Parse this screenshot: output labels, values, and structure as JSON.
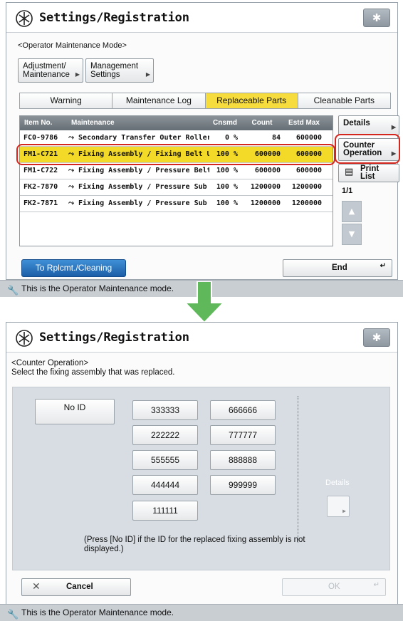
{
  "top": {
    "title": "Settings/Registration",
    "mode_label": "<Operator Maintenance Mode>",
    "nav": {
      "adjustment_line1": "Adjustment/",
      "adjustment_line2": "Maintenance",
      "management_line1": "Management",
      "management_line2": "Settings"
    },
    "tabs": [
      "Warning",
      "Maintenance Log",
      "Replaceable Parts",
      "Cleanable Parts"
    ],
    "active_tab": "Replaceable Parts",
    "table": {
      "headers": [
        "Item No.",
        "Maintenance",
        "Cnsmd",
        "Count",
        "Estd Max"
      ],
      "rows": [
        {
          "item": "FC0-9786",
          "name": "Secondary Transfer Outer Roller",
          "cnsmd": "0 %",
          "count": "84",
          "max": "600000"
        },
        {
          "item": "FM1-C721",
          "name": "Fixing Assembly / Fixing Belt Uni",
          "cnsmd": "100 %",
          "count": "600000",
          "max": "600000"
        },
        {
          "item": "FM1-C722",
          "name": "Fixing Assembly / Pressure Belt U",
          "cnsmd": "100 %",
          "count": "600000",
          "max": "600000"
        },
        {
          "item": "FK2-7870",
          "name": "Fixing Assembly / Pressure Sub Th",
          "cnsmd": "100 %",
          "count": "1200000",
          "max": "1200000"
        },
        {
          "item": "FK2-7871",
          "name": "Fixing Assembly / Pressure Sub Th",
          "cnsmd": "100 %",
          "count": "1200000",
          "max": "1200000"
        }
      ]
    },
    "side": {
      "details": "Details",
      "counter_line1": "Counter",
      "counter_line2": "Operation",
      "print_line1": "Print",
      "print_line2": "List",
      "page": "1/1"
    },
    "to_replacement": "To Rplcmt./Cleaning",
    "end": "End",
    "status": "This is the Operator Maintenance mode."
  },
  "bottom": {
    "title": "Settings/Registration",
    "header_line1": "<Counter Operation>",
    "header_line2": "Select the fixing assembly that was replaced.",
    "no_id": "No ID",
    "ids": [
      "333333",
      "666666",
      "222222",
      "777777",
      "555555",
      "888888",
      "444444",
      "999999",
      "111111"
    ],
    "details": "Details",
    "note_line1": "(Press [No ID] if the ID for the replaced fixing assembly is not",
    "note_line2": "displayed.)",
    "cancel": "Cancel",
    "ok": "OK",
    "status": "This is the Operator Maintenance mode."
  },
  "colors": {
    "selected_row": "#f3d928",
    "active_tab": "#f6dc3c",
    "highlight_ring": "#d4261d",
    "primary_button": "#1c5ea8",
    "transition_arrow": "#5fb85a"
  },
  "icons": [
    "settings-registration-icon",
    "gear-icon",
    "wrench-icon",
    "chevron-right-icon",
    "scroll-up-icon",
    "scroll-down-icon",
    "down-arrow-icon",
    "cancel-x-icon",
    "print-list-icon"
  ]
}
